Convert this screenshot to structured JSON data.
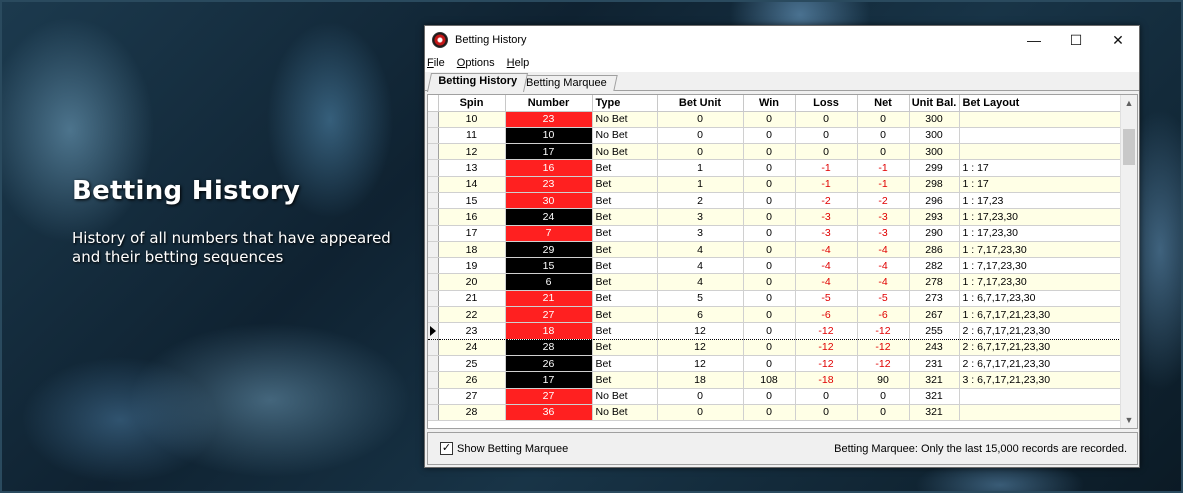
{
  "hero": {
    "title": "Betting History",
    "subtitle": "History of all numbers that have appeared and their betting sequences"
  },
  "window": {
    "title": "Betting History",
    "controls": {
      "minimize": "—",
      "maximize": "☐",
      "close": "✕"
    }
  },
  "menu": [
    {
      "underline": "F",
      "rest": "ile"
    },
    {
      "underline": "O",
      "rest": "ptions"
    },
    {
      "underline": "H",
      "rest": "elp"
    }
  ],
  "tabs": {
    "active": "Betting History",
    "inactive": "Betting Marquee"
  },
  "grid": {
    "headers": [
      "Spin",
      "Number",
      "Type",
      "Bet Unit",
      "Win",
      "Loss",
      "Net",
      "Unit Bal.",
      "Bet Layout"
    ],
    "current_spin": "23",
    "rows": [
      {
        "spin": "10",
        "number": "23",
        "color": "red",
        "type": "No Bet",
        "bet_unit": "0",
        "win": "0",
        "loss": "0",
        "net": "0",
        "bal": "300",
        "layout": ""
      },
      {
        "spin": "11",
        "number": "10",
        "color": "black",
        "type": "No Bet",
        "bet_unit": "0",
        "win": "0",
        "loss": "0",
        "net": "0",
        "bal": "300",
        "layout": ""
      },
      {
        "spin": "12",
        "number": "17",
        "color": "black",
        "type": "No Bet",
        "bet_unit": "0",
        "win": "0",
        "loss": "0",
        "net": "0",
        "bal": "300",
        "layout": ""
      },
      {
        "spin": "13",
        "number": "16",
        "color": "red",
        "type": "Bet",
        "bet_unit": "1",
        "win": "0",
        "loss": "-1",
        "net": "-1",
        "bal": "299",
        "layout": "1 : 17"
      },
      {
        "spin": "14",
        "number": "23",
        "color": "red",
        "type": "Bet",
        "bet_unit": "1",
        "win": "0",
        "loss": "-1",
        "net": "-1",
        "bal": "298",
        "layout": "1 : 17"
      },
      {
        "spin": "15",
        "number": "30",
        "color": "red",
        "type": "Bet",
        "bet_unit": "2",
        "win": "0",
        "loss": "-2",
        "net": "-2",
        "bal": "296",
        "layout": "1 : 17,23"
      },
      {
        "spin": "16",
        "number": "24",
        "color": "black",
        "type": "Bet",
        "bet_unit": "3",
        "win": "0",
        "loss": "-3",
        "net": "-3",
        "bal": "293",
        "layout": "1 : 17,23,30"
      },
      {
        "spin": "17",
        "number": "7",
        "color": "red",
        "type": "Bet",
        "bet_unit": "3",
        "win": "0",
        "loss": "-3",
        "net": "-3",
        "bal": "290",
        "layout": "1 : 17,23,30"
      },
      {
        "spin": "18",
        "number": "29",
        "color": "black",
        "type": "Bet",
        "bet_unit": "4",
        "win": "0",
        "loss": "-4",
        "net": "-4",
        "bal": "286",
        "layout": "1 : 7,17,23,30"
      },
      {
        "spin": "19",
        "number": "15",
        "color": "black",
        "type": "Bet",
        "bet_unit": "4",
        "win": "0",
        "loss": "-4",
        "net": "-4",
        "bal": "282",
        "layout": "1 : 7,17,23,30"
      },
      {
        "spin": "20",
        "number": "6",
        "color": "black",
        "type": "Bet",
        "bet_unit": "4",
        "win": "0",
        "loss": "-4",
        "net": "-4",
        "bal": "278",
        "layout": "1 : 7,17,23,30"
      },
      {
        "spin": "21",
        "number": "21",
        "color": "red",
        "type": "Bet",
        "bet_unit": "5",
        "win": "0",
        "loss": "-5",
        "net": "-5",
        "bal": "273",
        "layout": "1 : 6,7,17,23,30"
      },
      {
        "spin": "22",
        "number": "27",
        "color": "red",
        "type": "Bet",
        "bet_unit": "6",
        "win": "0",
        "loss": "-6",
        "net": "-6",
        "bal": "267",
        "layout": "1 : 6,7,17,21,23,30"
      },
      {
        "spin": "23",
        "number": "18",
        "color": "red",
        "type": "Bet",
        "bet_unit": "12",
        "win": "0",
        "loss": "-12",
        "net": "-12",
        "bal": "255",
        "layout": "2 : 6,7,17,21,23,30"
      },
      {
        "spin": "24",
        "number": "28",
        "color": "black",
        "type": "Bet",
        "bet_unit": "12",
        "win": "0",
        "loss": "-12",
        "net": "-12",
        "bal": "243",
        "layout": "2 : 6,7,17,21,23,30"
      },
      {
        "spin": "25",
        "number": "26",
        "color": "black",
        "type": "Bet",
        "bet_unit": "12",
        "win": "0",
        "loss": "-12",
        "net": "-12",
        "bal": "231",
        "layout": "2 : 6,7,17,21,23,30"
      },
      {
        "spin": "26",
        "number": "17",
        "color": "black",
        "type": "Bet",
        "bet_unit": "18",
        "win": "108",
        "loss": "-18",
        "net": "90",
        "bal": "321",
        "layout": "3 : 6,7,17,21,23,30"
      },
      {
        "spin": "27",
        "number": "27",
        "color": "red",
        "type": "No Bet",
        "bet_unit": "0",
        "win": "0",
        "loss": "0",
        "net": "0",
        "bal": "321",
        "layout": ""
      },
      {
        "spin": "28",
        "number": "36",
        "color": "red",
        "type": "No Bet",
        "bet_unit": "0",
        "win": "0",
        "loss": "0",
        "net": "0",
        "bal": "321",
        "layout": ""
      }
    ]
  },
  "status": {
    "checkbox_label": "Show Betting Marquee",
    "checked": true,
    "check_glyph": "✓",
    "note": "Betting Marquee: Only the last 15,000 records are recorded."
  },
  "scroll": {
    "up": "▲",
    "down": "▼"
  },
  "colors": {
    "red_cell": "#ff2020",
    "black_cell": "#000000",
    "negative_text": "#e00000",
    "alt_row": "#ffffe6"
  }
}
